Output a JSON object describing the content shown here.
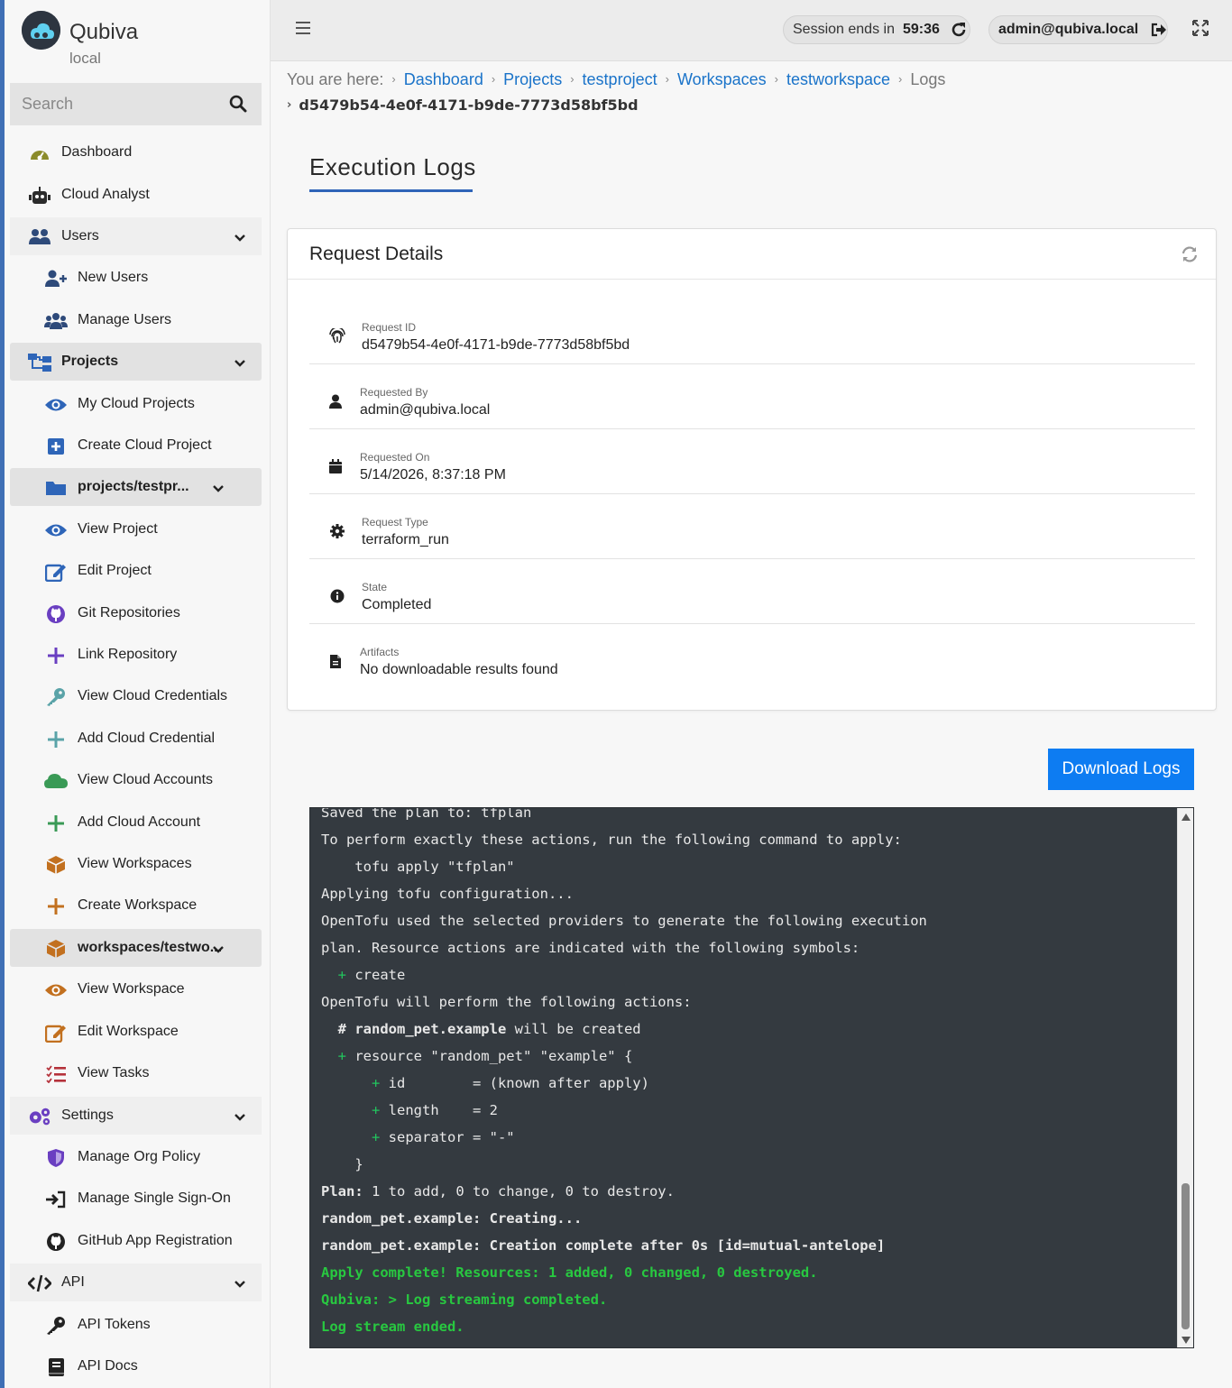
{
  "brand": {
    "name": "Qubiva",
    "env": "local"
  },
  "search": {
    "placeholder": "Search"
  },
  "sidebar": {
    "items": [
      {
        "label": "Dashboard",
        "icon": "gauge-icon"
      },
      {
        "label": "Cloud Analyst",
        "icon": "robot-icon"
      },
      {
        "label": "Users",
        "icon": "users-icon"
      },
      {
        "label": "New Users",
        "icon": "user-plus-icon"
      },
      {
        "label": "Manage Users",
        "icon": "users-cog-icon"
      },
      {
        "label": "Projects",
        "icon": "sitemap-icon"
      },
      {
        "label": "My Cloud Projects",
        "icon": "eye-icon"
      },
      {
        "label": "Create Cloud Project",
        "icon": "plus-square-icon"
      },
      {
        "label": "projects/testpr...",
        "icon": "folder-icon"
      },
      {
        "label": "View Project",
        "icon": "eye-icon"
      },
      {
        "label": "Edit Project",
        "icon": "edit-icon"
      },
      {
        "label": "Git Repositories",
        "icon": "github-icon"
      },
      {
        "label": "Link Repository",
        "icon": "plus-icon"
      },
      {
        "label": "View Cloud Credentials",
        "icon": "key-icon"
      },
      {
        "label": "Add Cloud Credential",
        "icon": "plus-icon"
      },
      {
        "label": "View Cloud Accounts",
        "icon": "cloud-icon"
      },
      {
        "label": "Add Cloud Account",
        "icon": "plus-icon"
      },
      {
        "label": "View Workspaces",
        "icon": "box-icon"
      },
      {
        "label": "Create Workspace",
        "icon": "plus-icon"
      },
      {
        "label": "workspaces/testwo...",
        "icon": "box-icon"
      },
      {
        "label": "View Workspace",
        "icon": "eye-icon"
      },
      {
        "label": "Edit Workspace",
        "icon": "edit-icon"
      },
      {
        "label": "View Tasks",
        "icon": "tasks-icon"
      },
      {
        "label": "Settings",
        "icon": "cogs-icon"
      },
      {
        "label": "Manage Org Policy",
        "icon": "shield-icon"
      },
      {
        "label": "Manage Single Sign-On",
        "icon": "sign-in-icon"
      },
      {
        "label": "GitHub App Registration",
        "icon": "github-icon"
      },
      {
        "label": "API",
        "icon": "code-icon"
      },
      {
        "label": "API Tokens",
        "icon": "key-icon"
      },
      {
        "label": "API Docs",
        "icon": "book-icon"
      }
    ]
  },
  "topbar": {
    "session_label": "Session ends in",
    "session_time": "59:36",
    "user_email": "admin@qubiva.local"
  },
  "breadcrumb": {
    "prefix": "You are here:",
    "links": [
      "Dashboard",
      "Projects",
      "testproject",
      "Workspaces",
      "testworkspace"
    ],
    "current": "Logs",
    "request_id": "d5479b54-4e0f-4171-b9de-7773d58bf5bd"
  },
  "page": {
    "title": "Execution Logs"
  },
  "card": {
    "title": "Request Details",
    "details": [
      {
        "key": "Request ID",
        "value": "d5479b54-4e0f-4171-b9de-7773d58bf5bd",
        "icon": "fingerprint-icon"
      },
      {
        "key": "Requested By",
        "value": "admin@qubiva.local",
        "icon": "user-icon"
      },
      {
        "key": "Requested On",
        "value": "5/14/2026, 8:37:18 PM",
        "icon": "calendar-icon"
      },
      {
        "key": "Request Type",
        "value": "terraform_run",
        "icon": "gear-icon"
      },
      {
        "key": "State",
        "value": "Completed",
        "icon": "info-icon"
      },
      {
        "key": "Artifacts",
        "value": "No downloadable results found",
        "icon": "file-icon"
      }
    ]
  },
  "download_label": "Download Logs",
  "log_lines": [
    {
      "text": "Saved the plan to: tfplan",
      "style": ""
    },
    {
      "text": "To perform exactly these actions, run the following command to apply:",
      "style": ""
    },
    {
      "text": "    tofu apply \"tfplan\"",
      "style": ""
    },
    {
      "text": "Applying tofu configuration...",
      "style": ""
    },
    {
      "text": "OpenTofu used the selected providers to generate the following execution",
      "style": ""
    },
    {
      "text": "plan. Resource actions are indicated with the following symbols:",
      "style": ""
    },
    {
      "prefix": "  + ",
      "text": "create",
      "style": "plus"
    },
    {
      "text": "OpenTofu will perform the following actions:",
      "style": ""
    },
    {
      "prefix": "  # ",
      "bold": "random_pet.example",
      "text": " will be created",
      "style": "hash"
    },
    {
      "prefix": "  + ",
      "text": "resource \"random_pet\" \"example\" {",
      "style": "plus"
    },
    {
      "prefix": "      + ",
      "text": "id        = (known after apply)",
      "style": "plus"
    },
    {
      "prefix": "      + ",
      "text": "length    = 2",
      "style": "plus"
    },
    {
      "prefix": "      + ",
      "text": "separator = \"-\"",
      "style": "plus"
    },
    {
      "text": "    }",
      "style": ""
    },
    {
      "bold": "Plan:",
      "text": " 1 to add, 0 to change, 0 to destroy.",
      "style": "plan"
    },
    {
      "text": "random_pet.example: Creating...",
      "style": "bold"
    },
    {
      "text": "random_pet.example: Creation complete after 0s [id=mutual-antelope]",
      "style": "bold"
    },
    {
      "text": "Apply complete! Resources: 1 added, 0 changed, 0 destroyed.",
      "style": "green"
    },
    {
      "text": "Qubiva: > Log streaming completed.",
      "style": "green"
    },
    {
      "text": "Log stream ended.",
      "style": "green"
    }
  ],
  "colors": {
    "accent": "#0d7cf2",
    "link": "#1a73c9",
    "console_bg": "#343a40",
    "success": "#28c840"
  }
}
